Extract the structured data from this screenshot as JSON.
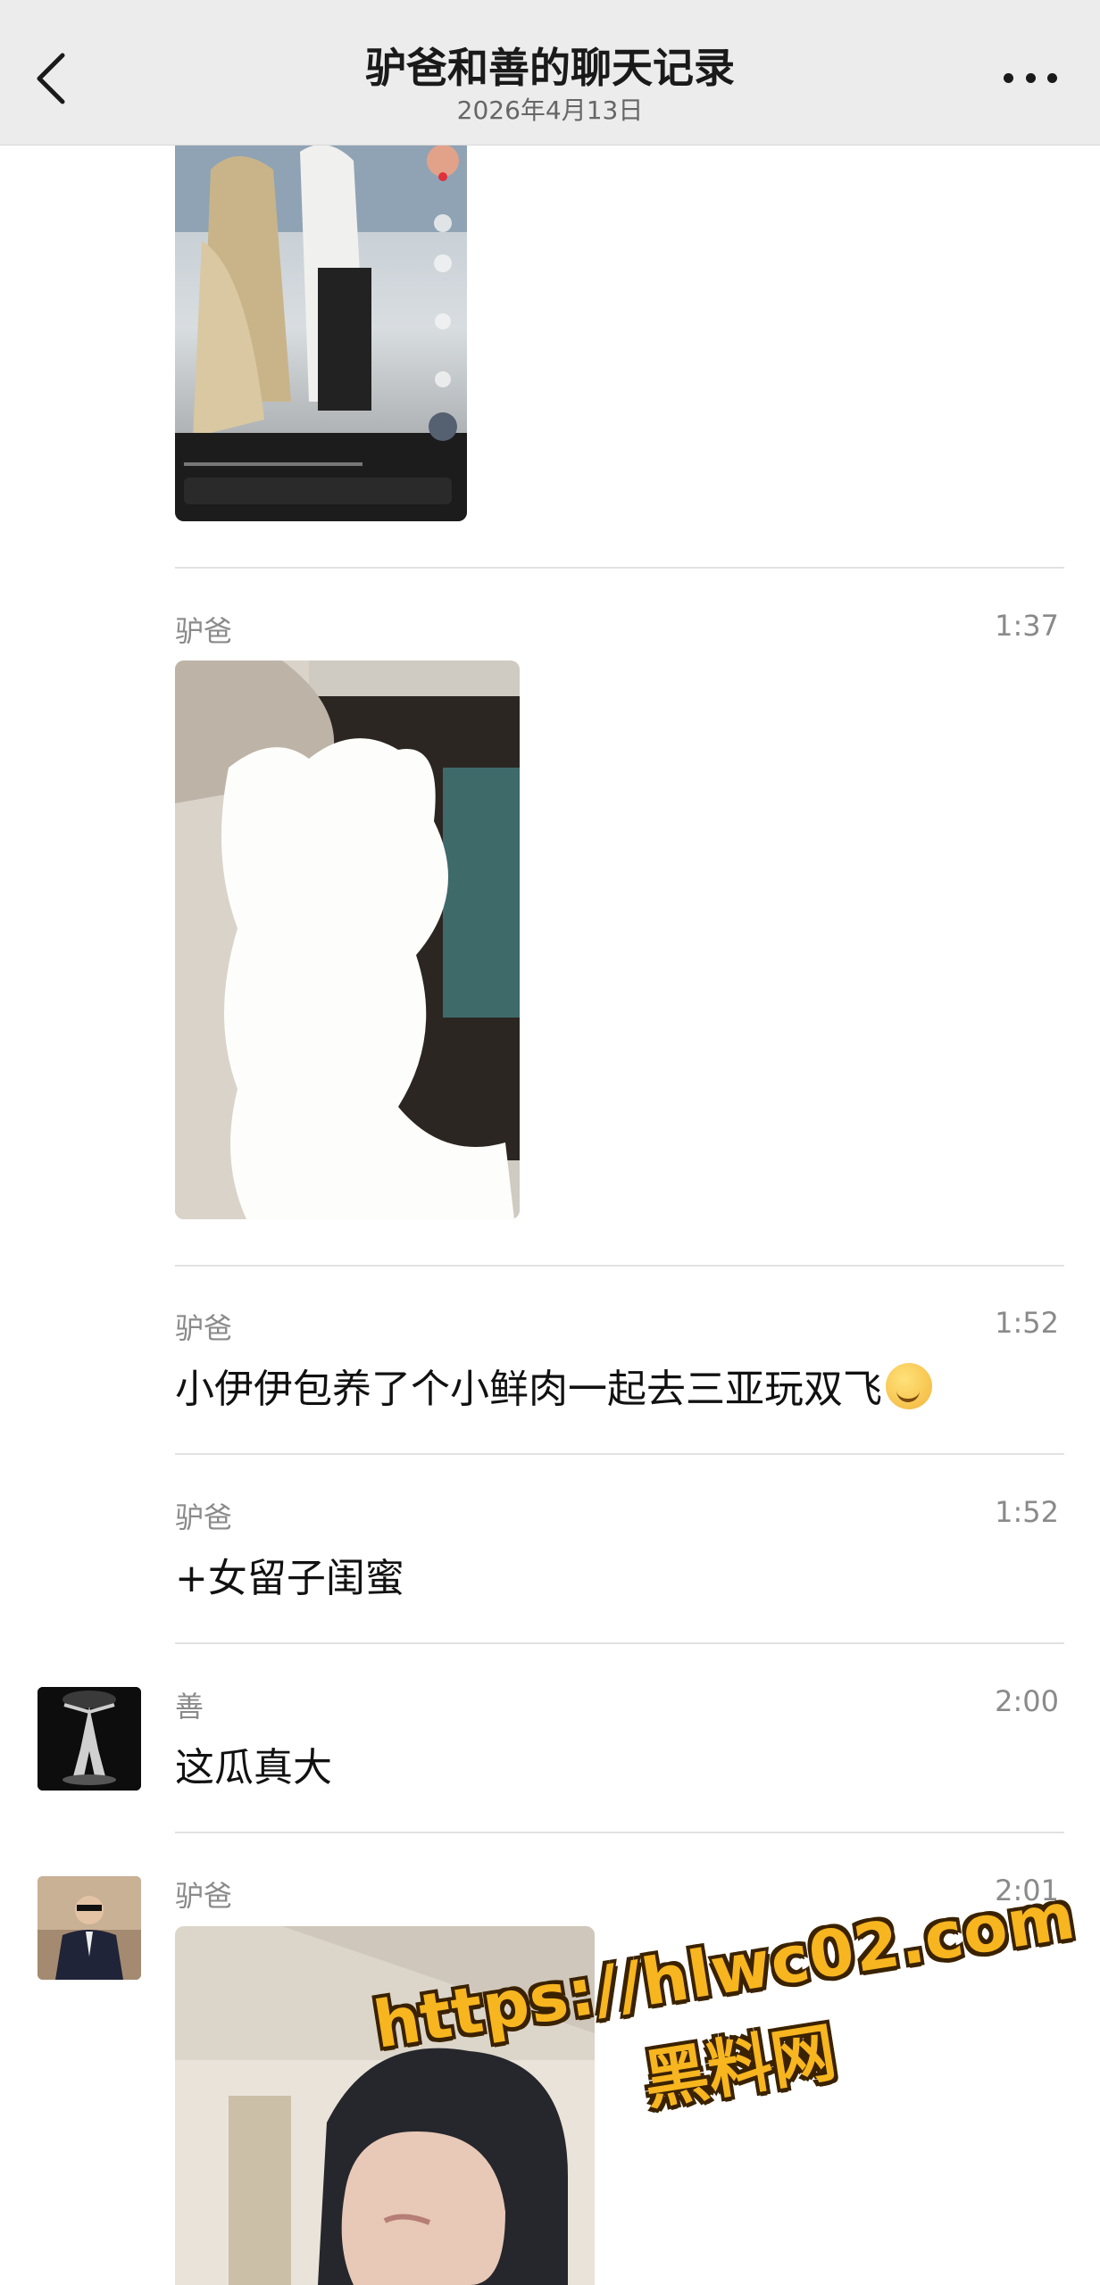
{
  "header": {
    "title": "驴爸和善的聊天记录",
    "date": "2026年4月13日",
    "back_icon": "chevron-left-icon",
    "more_icon": "more-dots-icon"
  },
  "messages": [
    {
      "sender": "驴爸",
      "time": "1:37",
      "type": "image"
    },
    {
      "sender": "驴爸",
      "time": "1:52",
      "text": "小伊伊包养了个小鲜肉一起去三亚玩双飞",
      "emoji": "laughing-emoji"
    },
    {
      "sender": "驴爸",
      "time": "1:52",
      "text": "+女留子闺蜜"
    },
    {
      "sender": "善",
      "time": "2:00",
      "text": "这瓜真大"
    },
    {
      "sender": "驴爸",
      "time": "2:01",
      "type": "image"
    }
  ],
  "watermark": {
    "url": "https://hlwc02.com",
    "name": "黑料网"
  },
  "colors": {
    "header_bg": "#ececec",
    "watermark": "#f7b51f",
    "meta_text": "#8a8a8a"
  }
}
